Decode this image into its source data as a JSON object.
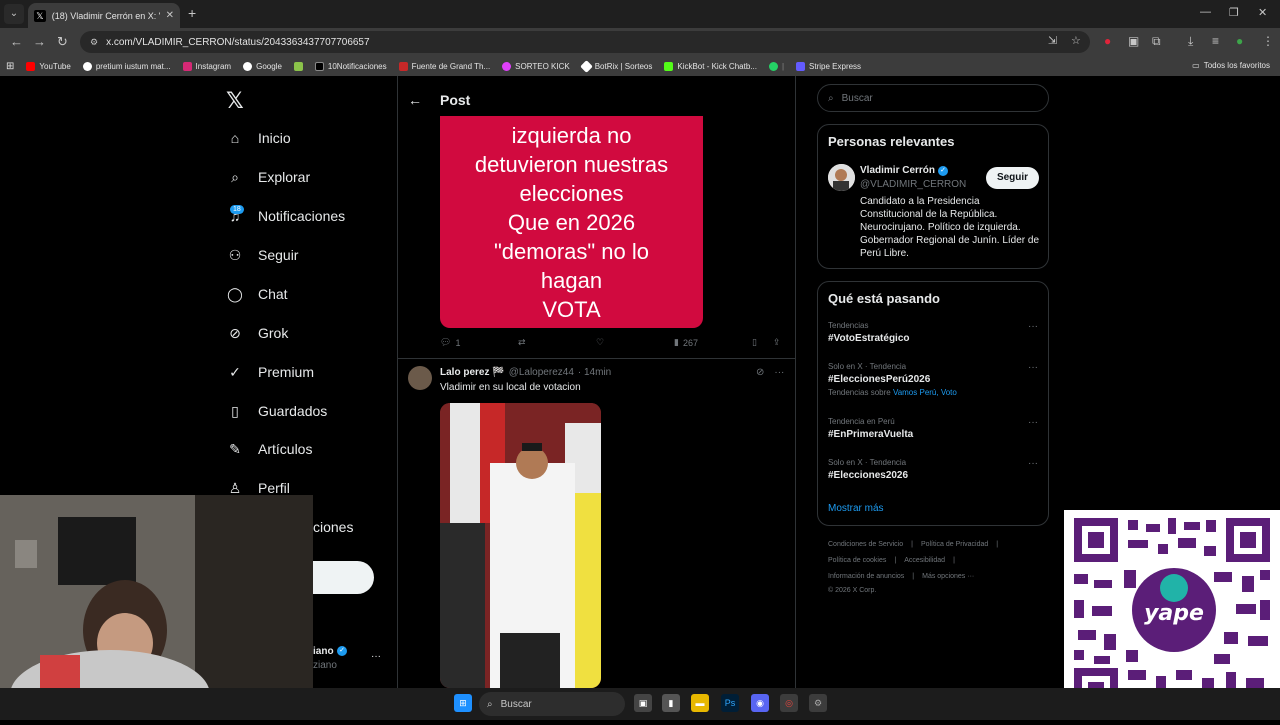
{
  "browser": {
    "tab_title": "(18) Vladimir Cerrón en X: \"Pa...",
    "url": "x.com/VLADIMIR_CERRON/status/2043363437707706657",
    "bookmarks": [
      "YouTube",
      "pretium iustum mat...",
      "Instagram",
      "Google",
      "10Notificaciones",
      "Fuente de Grand Th...",
      "SORTEO KICK",
      "BotRix | Sorteos",
      "KickBot - Kick Chatb...",
      "Stripe Express"
    ],
    "all_bookmarks": "Todos los favoritos"
  },
  "sidebar": {
    "items": [
      {
        "label": "Inicio",
        "icon": "home-icon"
      },
      {
        "label": "Explorar",
        "icon": "search-icon"
      },
      {
        "label": "Notificaciones",
        "icon": "bell-icon"
      },
      {
        "label": "Seguir",
        "icon": "add-person-icon"
      },
      {
        "label": "Chat",
        "icon": "chat-icon"
      },
      {
        "label": "Grok",
        "icon": "grok-icon"
      },
      {
        "label": "Premium",
        "icon": "premium-icon"
      },
      {
        "label": "Guardados",
        "icon": "bookmark-icon"
      },
      {
        "label": "Artículos",
        "icon": "article-icon"
      },
      {
        "label": "Perfil",
        "icon": "person-icon"
      }
    ],
    "notif_badge": "18",
    "more_partial": "ciones",
    "account_partial_name": "iano",
    "account_partial_handle": "ziano"
  },
  "main": {
    "header_title": "Post",
    "image_text_lines": [
      "izquierda no",
      "detuvieron nuestras",
      "elecciones",
      "Que en 2026",
      "\"demoras\" no lo",
      "hagan",
      "VOTA"
    ],
    "actions": {
      "replies": "1",
      "views": "267"
    },
    "reply": {
      "name": "Lalo perez 🏁",
      "handle": "@Laloperez",
      "handle_suffix": "44",
      "time": "· 14min",
      "text": "Vladimir en su local de votacion"
    }
  },
  "right": {
    "search_placeholder": "Buscar",
    "relevant_title": "Personas relevantes",
    "person": {
      "name": "Vladimir Cerrón",
      "handle": "@VLADIMIR_CERRON",
      "follow_label": "Seguir",
      "bio": "Candidato a la Presidencia Constitucional de la República. Neurocirujano. Político de izquierda. Gobernador Regional de Junín. Líder de Perú Libre."
    },
    "trending_title": "Qué está pasando",
    "trends": [
      {
        "context": "Tendencias",
        "tag": "#VotoEstratégico",
        "sub": ""
      },
      {
        "context": "Solo en X · Tendencia",
        "tag": "#EleccionesPerú2026",
        "sub": "Tendencias sobre",
        "sub_links": "Vamos Perú, Voto"
      },
      {
        "context": "Tendencia en Perú",
        "tag": "#EnPrimeraVuelta",
        "sub": ""
      },
      {
        "context": "Solo en X · Tendencia",
        "tag": "#Elecciones2026",
        "sub": ""
      }
    ],
    "show_more": "Mostrar más",
    "footer": {
      "row1": [
        "Condiciones de Servicio",
        "|",
        "Política de Privacidad",
        "|"
      ],
      "row2": [
        "Política de cookies",
        "|",
        "Accesibilidad",
        "|"
      ],
      "row3": [
        "Información de anuncios",
        "|",
        "Más opciones ···"
      ],
      "copyright": "© 2026 X Corp."
    }
  },
  "taskbar": {
    "search_label": "Buscar"
  },
  "colors": {
    "accent": "#1d9bf0",
    "image_bg": "#d10a3f",
    "qr": "#5b1e78"
  }
}
